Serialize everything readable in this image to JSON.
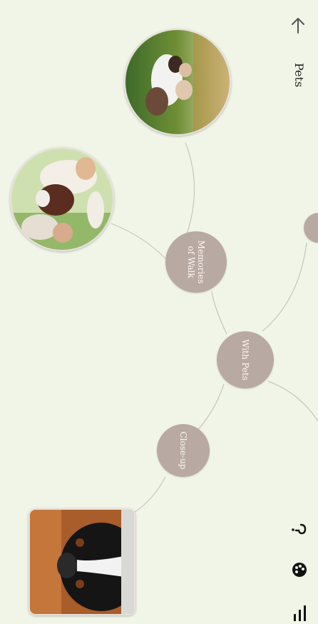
{
  "header": {
    "title": "Pets",
    "back_icon": "arrow-left-icon"
  },
  "mindmap": {
    "center_node": "With Pets",
    "nodes": [
      {
        "label": "Memories of Walk"
      },
      {
        "label": "Close-up"
      }
    ]
  },
  "toolbar": {
    "help_icon": "help-icon",
    "palette_icon": "palette-icon",
    "menu_icon": "bars-icon"
  },
  "colors": {
    "background": "#f0f5e8",
    "node": "#b9a9a3",
    "line": "#c9c4bd"
  }
}
